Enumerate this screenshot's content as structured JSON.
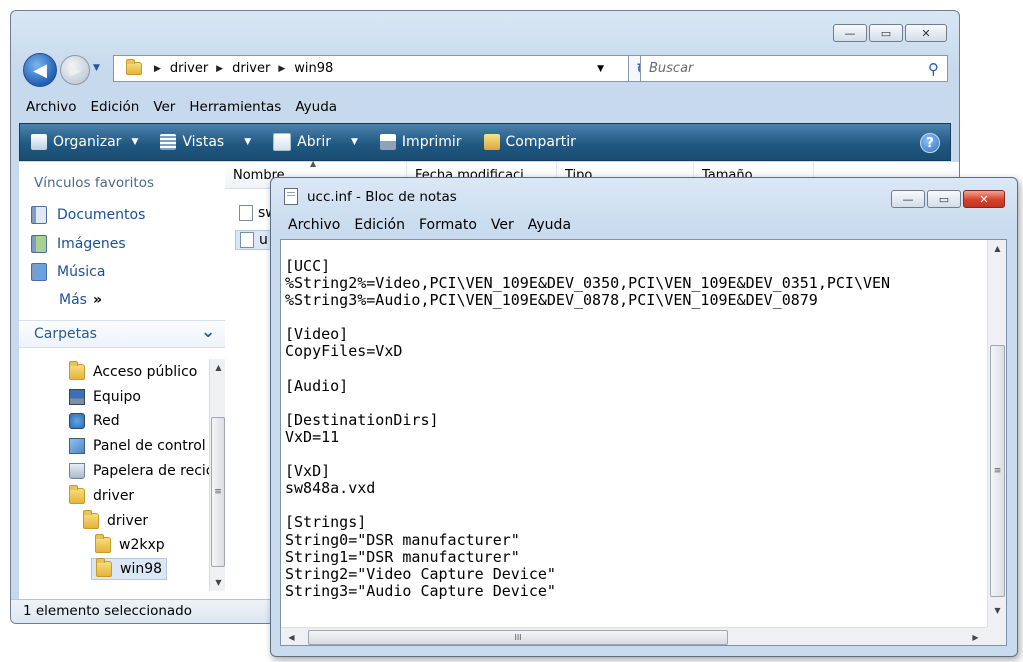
{
  "explorer": {
    "nav": {
      "back_glyph": "◀",
      "forward_glyph": "▶",
      "dropdown_glyph": "▼"
    },
    "address": {
      "crumbs": [
        "driver",
        "driver",
        "win98"
      ],
      "separator_glyph": "▶",
      "dropdown_glyph": "▼"
    },
    "search": {
      "placeholder": "Buscar",
      "icon": "search-icon"
    },
    "menu": [
      "Archivo",
      "Edición",
      "Ver",
      "Herramientas",
      "Ayuda"
    ],
    "toolbar": {
      "items": [
        {
          "label": "Organizar",
          "icon": "organize-icon",
          "color": "#ffffff"
        },
        {
          "label": "Vistas",
          "icon": "views-icon",
          "color": "#ffffff"
        },
        {
          "label": "Abrir",
          "icon": "open-icon",
          "color": "#ffffff"
        },
        {
          "label": "Imprimir",
          "icon": "printer-icon",
          "color": "#ffffff"
        },
        {
          "label": "Compartir",
          "icon": "share-icon",
          "color": "#ffffff"
        }
      ],
      "help_glyph": "?"
    },
    "favorites": {
      "heading": "Vínculos favoritos",
      "items": [
        "Documentos",
        "Imágenes",
        "Música"
      ],
      "more_label": "Más",
      "more_glyph": "»"
    },
    "folders": {
      "heading": "Carpetas",
      "collapse_glyph": "⌄",
      "items": [
        "Acceso público",
        "Equipo",
        "Red",
        "Panel de control",
        "Papelera de recic",
        "driver",
        "driver",
        "w2kxp",
        "win98"
      ]
    },
    "columns": [
      "Nombre",
      "Fecha modificaci",
      "Tipo",
      "Tamaño"
    ],
    "files": [
      "sw",
      "u"
    ],
    "status": "1 elemento seleccionado",
    "accent_color": "#1c4f9a",
    "toolbar_color": "#205982"
  },
  "notepad": {
    "title": "ucc.inf - Bloc de notas",
    "menu": [
      "Archivo",
      "Edición",
      "Formato",
      "Ver",
      "Ayuda"
    ],
    "content": "[UCC]\n%String2%=Video,PCI\\VEN_109E&DEV_0350,PCI\\VEN_109E&DEV_0351,PCI\\VEN\n%String3%=Audio,PCI\\VEN_109E&DEV_0878,PCI\\VEN_109E&DEV_0879\n\n[Video]\nCopyFiles=VxD\n\n[Audio]\n\n[DestinationDirs]\nVxD=11\n\n[VxD]\nsw848a.vxd\n\n[Strings]\nString0=\"DSR manufacturer\"\nString1=\"DSR manufacturer\"\nString2=\"Video Capture Device\"\nString3=\"Audio Capture Device\"",
    "scroll_glyphs": {
      "up": "▲",
      "down": "▼",
      "left": "◀",
      "right": "▶",
      "grip": "≡",
      "grip_h": "III"
    }
  },
  "window_buttons": {
    "minimize": "—",
    "maximize": "▭",
    "close": "✕"
  }
}
